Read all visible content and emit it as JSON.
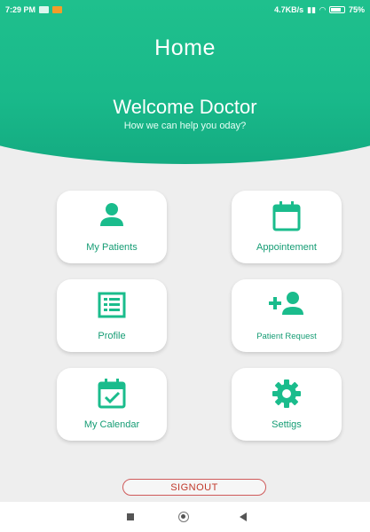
{
  "statusbar": {
    "time": "7:29 PM",
    "network_speed": "4.7KB/s",
    "battery": "75%"
  },
  "header": {
    "title": "Home",
    "welcome": "Welcome Doctor",
    "subtitle": "How we can help you oday?"
  },
  "menu": {
    "my_patients": "My Patients",
    "appointment": "Appointement",
    "profile": "Profile",
    "patient_request": "Patient Request",
    "my_calendar": "My Calendar",
    "settings": "Settigs"
  },
  "signout_label": "SIGNOUT",
  "colors": {
    "accent": "#1abc8c",
    "signout_border": "#cf5a5a"
  },
  "icons": {
    "my_patients": "person-icon",
    "appointment": "calendar-icon",
    "profile": "list-icon",
    "patient_request": "add-person-icon",
    "my_calendar": "calendar-check-icon",
    "settings": "gear-icon"
  }
}
